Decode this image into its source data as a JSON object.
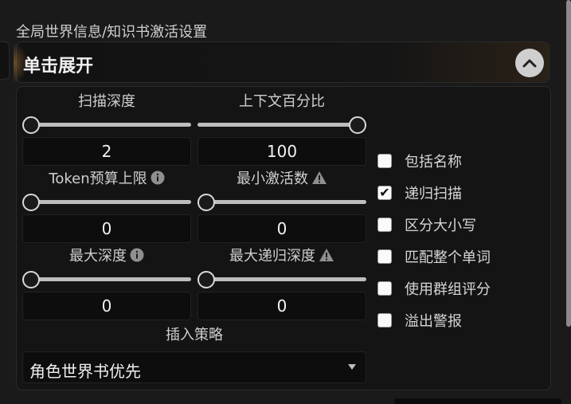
{
  "section_title": "全局世界信息/知识书激活设置",
  "drawer": {
    "title": "单击展开",
    "toggle_icon": "chevron-up-icon"
  },
  "sliders": [
    {
      "id": "scan-depth",
      "label": "扫描深度",
      "value": "2",
      "fraction": 0.0,
      "icon": ""
    },
    {
      "id": "context-percent",
      "label": "上下文百分比",
      "value": "100",
      "fraction": 1.0,
      "icon": ""
    },
    {
      "id": "token-budget-cap",
      "label": "Token预算上限",
      "value": "0",
      "fraction": 0.0,
      "icon": "info-icon"
    },
    {
      "id": "min-activations",
      "label": "最小激活数",
      "value": "0",
      "fraction": 0.0,
      "icon": "warning-icon"
    },
    {
      "id": "max-depth",
      "label": "最大深度",
      "value": "0",
      "fraction": 0.0,
      "icon": "info-icon"
    },
    {
      "id": "max-recursion-depth",
      "label": "最大递归深度",
      "value": "0",
      "fraction": 0.0,
      "icon": "warning-icon"
    }
  ],
  "checkboxes": [
    {
      "label": "包括名称",
      "checked": false
    },
    {
      "label": "递归扫描",
      "checked": true
    },
    {
      "label": "区分大小写",
      "checked": false
    },
    {
      "label": "匹配整个单词",
      "checked": false
    },
    {
      "label": "使用群组评分",
      "checked": false
    },
    {
      "label": "溢出警报",
      "checked": false
    }
  ],
  "insertion_strategy": {
    "label": "插入策略",
    "selected": "角色世界书优先"
  }
}
